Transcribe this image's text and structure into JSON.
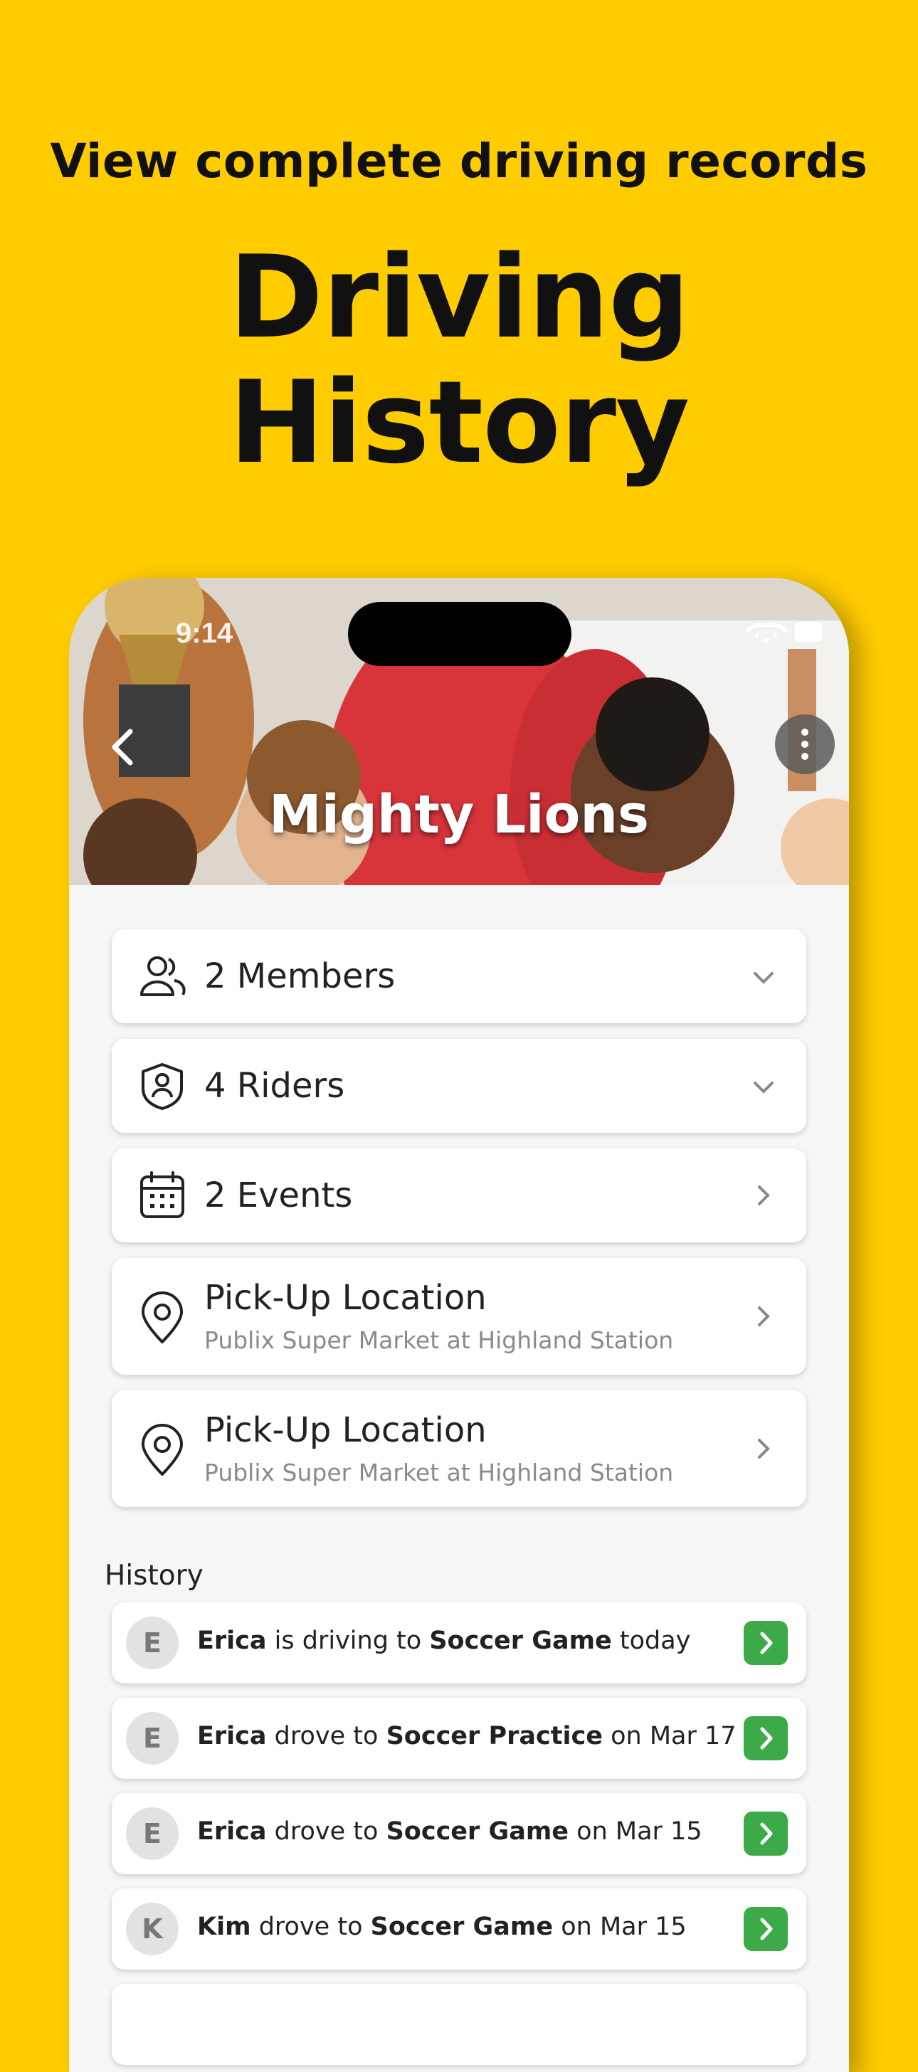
{
  "promo": {
    "subheading": "View complete driving records",
    "heading": "Driving History"
  },
  "status_bar": {
    "time": "9:14"
  },
  "team": {
    "name": "Mighty Lions"
  },
  "cards": [
    {
      "title": "2 Members",
      "icon": "users-icon",
      "chevron": "down"
    },
    {
      "title": "4 Riders",
      "icon": "rider-badge-icon",
      "chevron": "down"
    },
    {
      "title": "2 Events",
      "icon": "calendar-icon",
      "chevron": "right"
    },
    {
      "title": "Pick-Up Location",
      "subtitle": "Publix Super Market at Highland Station",
      "icon": "location-pin-icon",
      "chevron": "right"
    },
    {
      "title": "Pick-Up Location",
      "subtitle": "Publix Super Market at Highland Station",
      "icon": "location-pin-icon",
      "chevron": "right"
    }
  ],
  "history": {
    "label": "History",
    "items": [
      {
        "avatar": "E",
        "name": "Erica",
        "verb": " is driving to ",
        "event": "Soccer Game",
        "when": " today"
      },
      {
        "avatar": "E",
        "name": "Erica",
        "verb": " drove to ",
        "event": "Soccer Practice",
        "when": " on Mar 17"
      },
      {
        "avatar": "E",
        "name": "Erica",
        "verb": " drove to ",
        "event": "Soccer Game",
        "when": " on Mar 15"
      },
      {
        "avatar": "K",
        "name": "Kim",
        "verb": " drove to ",
        "event": "Soccer Game",
        "when": " on Mar 15"
      }
    ]
  },
  "colors": {
    "background": "#FFCC00",
    "accent_green": "#3DAA4A"
  }
}
